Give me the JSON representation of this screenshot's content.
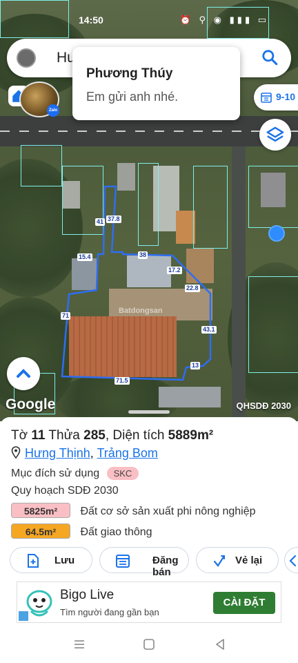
{
  "status_bar": {
    "time": "14:50",
    "icons": "⏰ ⚲ ◉ ▮▮▮ ▭"
  },
  "search": {
    "text": "Hưn"
  },
  "notification": {
    "sender": "Phương Thúy",
    "message": "Em gửi anh  nhé."
  },
  "map": {
    "date_chip": "9-10",
    "watermark": "Batdongsan",
    "overlay_label": "QHSDĐ 2030",
    "google": "Google",
    "zalo_badge": "Zalo",
    "dimensions": [
      "41",
      "37.8",
      "15.4",
      "38",
      "17.2",
      "22.8",
      "71",
      "43.1",
      "13",
      "71.5"
    ]
  },
  "parcel": {
    "title_parts": {
      "to_label": "Tờ",
      "to_value": "11",
      "thua_label": "Thửa",
      "thua_value": "285",
      "area_label": ", Diện tích",
      "area_value": "5889m²"
    },
    "commune": "Hưng Thịnh",
    "separator": ",",
    "district": "Trảng Bom",
    "purpose_label": "Mục đích sử dụng",
    "purpose_code": "SKC",
    "plan_label": "Quy hoạch SDĐ 2030",
    "areas": [
      {
        "value": "5825m²",
        "label": "Đất cơ sở sản xuất phi nông nghiệp",
        "color": "#f9bfc4"
      },
      {
        "value": "64.5m²",
        "label": "Đất giao thông",
        "color": "#f5a623"
      }
    ]
  },
  "actions": {
    "save": "Lưu",
    "post": "Đăng bán",
    "redraw": "Vẻ lại"
  },
  "ad": {
    "title": "Bigo Live",
    "subtitle": "Tìm người đang gần bạn",
    "cta": "CÀI ĐẶT"
  },
  "colors": {
    "accent": "#1a73e8",
    "parcel_outline": "#2f6df2",
    "cta": "#2e7d32"
  }
}
